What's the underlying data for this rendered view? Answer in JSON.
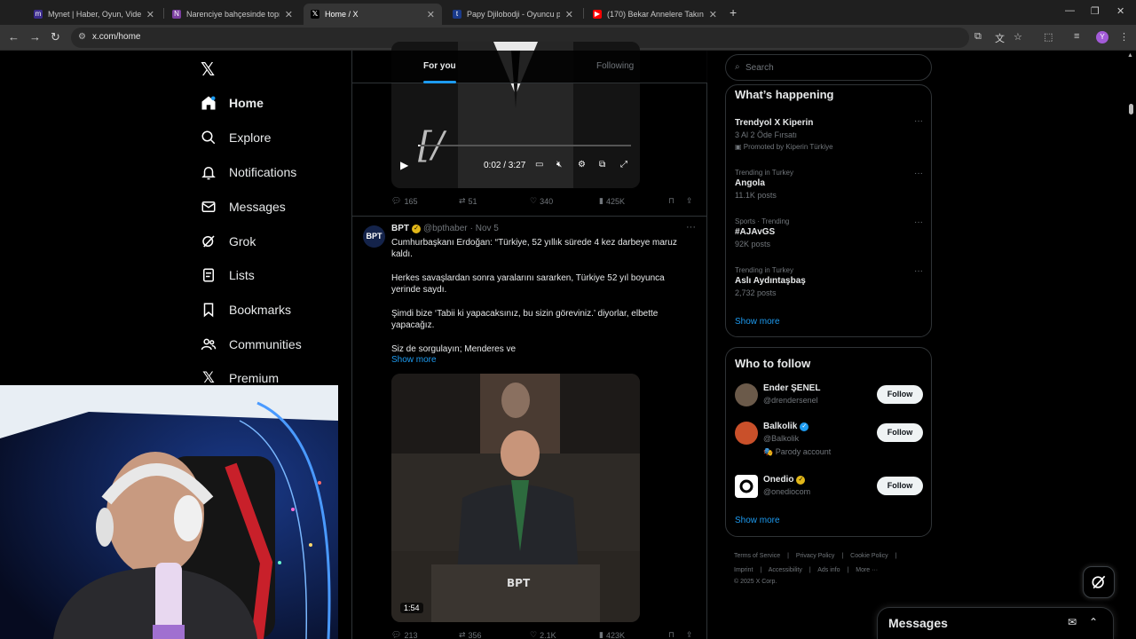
{
  "browser": {
    "tabs": [
      {
        "title": "Mynet | Haber, Oyun, Video, Spor",
        "favicon": "mynet-icon",
        "fav_color": "#3b2b8c"
      },
      {
        "title": "Narenciye bahçesinde toprağa",
        "favicon": "site-icon",
        "fav_color": "#7b3fa0"
      },
      {
        "title": "Home / X",
        "favicon": "x-icon",
        "fav_color": "#000000"
      },
      {
        "title": "Papy Djilobodji - Oyuncu profili",
        "favicon": "transfermarkt-icon",
        "fav_color": "#1a3a8a"
      },
      {
        "title": "(170) Bekar Annelere Takıntılı Olan",
        "favicon": "youtube-icon",
        "fav_color": "#ff0000"
      }
    ],
    "url": "x.com/home",
    "profile_initial": "Y"
  },
  "nav": {
    "items": [
      {
        "label": "Home",
        "icon": "home-icon"
      },
      {
        "label": "Explore",
        "icon": "search-icon"
      },
      {
        "label": "Notifications",
        "icon": "bell-icon"
      },
      {
        "label": "Messages",
        "icon": "mail-icon"
      },
      {
        "label": "Grok",
        "icon": "grok-icon"
      },
      {
        "label": "Lists",
        "icon": "list-icon"
      },
      {
        "label": "Bookmarks",
        "icon": "bookmark-icon"
      },
      {
        "label": "Communities",
        "icon": "people-icon"
      },
      {
        "label": "Premium",
        "icon": "x-icon"
      }
    ]
  },
  "feed": {
    "tabs": {
      "for_you": "For you",
      "following": "Following"
    },
    "tweet1": {
      "video_time": "0:02 / 3:27",
      "video_progress": 0.01,
      "replies": "165",
      "reposts": "51",
      "likes": "340",
      "views": "425K"
    },
    "tweet2": {
      "avatar_text": "BPT",
      "name": "BPT",
      "handle": "@bpthaber",
      "date": "· Nov 5",
      "lines": [
        "Cumhurbaşkanı Erdoğan: “Türkiye, 52 yıllık sürede 4 kez darbeye maruz",
        "kaldı.",
        "Herkes savaşlardan sonra yaralarını sararken, Türkiye 52 yıl boyunca",
        "yerinde saydı.",
        "Şimdi bize ‘Tabii ki yapacaksınız, bu sizin göreviniz.’ diyorlar, elbette",
        "yapacağız.",
        "Siz de sorgulayın; Menderes ve"
      ],
      "show_more": "Show more",
      "video_duration": "1:54",
      "replies": "213",
      "reposts": "356",
      "likes": "2.1K",
      "views": "423K"
    }
  },
  "sidebar": {
    "search_placeholder": "Search",
    "happening_title": "What’s happening",
    "trends": [
      {
        "category": "",
        "name": "Trendyol X Kiperin",
        "sub": "3 Al 2 Öde Fırsatı",
        "promo": "Promoted by Kiperin Türkiye"
      },
      {
        "category": "Trending in Turkey",
        "name": "Angola",
        "sub": "11.1K posts"
      },
      {
        "category": "Sports · Trending",
        "name": "#AJAvGS",
        "sub": "92K posts"
      },
      {
        "category": "Trending in Turkey",
        "name": "Aslı Aydıntaşbaş",
        "sub": "2,732 posts"
      }
    ],
    "trends_show_more": "Show more",
    "wtf_title": "Who to follow",
    "who_to_follow": [
      {
        "name": "Ender ŞENEL",
        "handle": "@drendersenel",
        "extra": "",
        "badge": "",
        "button": "Follow",
        "avatar_color": "#6b5a4a"
      },
      {
        "name": "Balkolik",
        "handle": "@Balkolik",
        "extra": "🎭 Parody account",
        "badge": "blue",
        "button": "Follow",
        "avatar_color": "#c9502a"
      },
      {
        "name": "Onedio",
        "handle": "@onediocom",
        "extra": "",
        "badge": "gold",
        "button": "Follow",
        "avatar_color": "#ffffff"
      }
    ],
    "wtf_show_more": "Show more",
    "footer": {
      "line1": [
        "Terms of Service",
        "|",
        "Privacy Policy",
        "|",
        "Cookie Policy",
        "|"
      ],
      "line2": [
        "Imprint",
        "|",
        "Accessibility",
        "|",
        "Ads info",
        "|",
        "More ···"
      ],
      "copyright": "© 2025 X Corp."
    }
  },
  "messages_bar": {
    "title": "Messages"
  },
  "colors": {
    "accent": "#1d9bf0",
    "background": "#000000",
    "border": "#2f3336"
  }
}
